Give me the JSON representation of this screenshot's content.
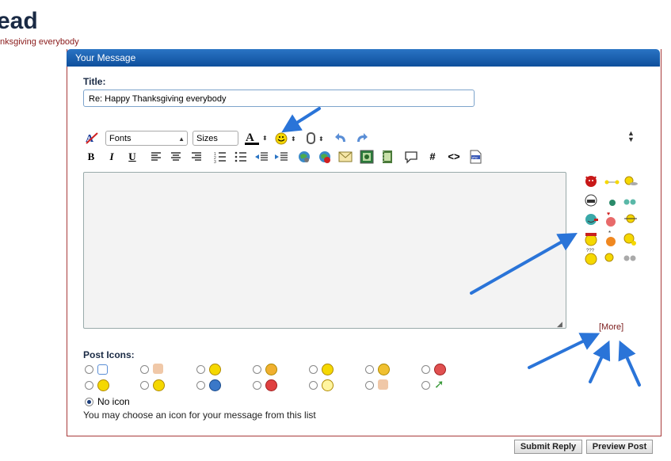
{
  "page": {
    "title_fragment": "ead",
    "subtitle_fragment": "nksgiving everybody"
  },
  "panel": {
    "header": "Your Message"
  },
  "title_field": {
    "label": "Title:",
    "value": "Re: Happy Thanksgiving everybody"
  },
  "toolbar": {
    "font_select": "Fonts",
    "size_select": "Sizes",
    "bold": "B",
    "italic": "I",
    "underline": "U",
    "hash": "#",
    "code": "<>"
  },
  "smilies": {
    "more_label": "[More]"
  },
  "post_icons": {
    "label": "Post Icons:",
    "no_icon_label": "No icon",
    "help_text": "You may choose an icon for your message from this list"
  },
  "buttons": {
    "submit": "Submit Reply",
    "preview": "Preview Post"
  },
  "colors": {
    "panel_header": "#1565b8",
    "panel_border": "#a83a3a",
    "link": "#7a1a1a",
    "annotation_arrow": "#2a74d8"
  }
}
